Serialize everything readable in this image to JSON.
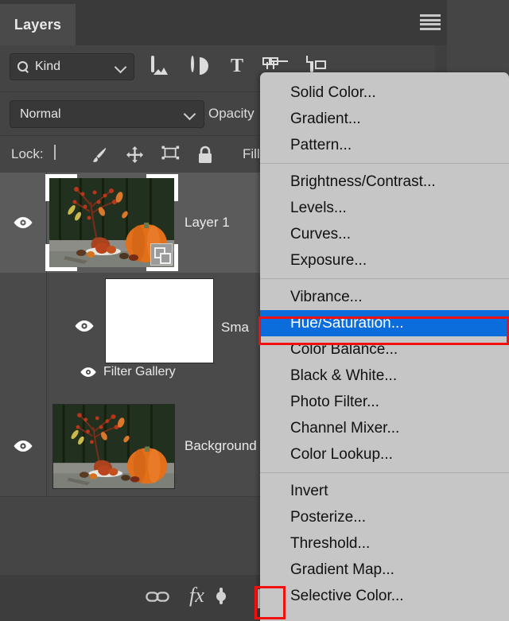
{
  "panel": {
    "tab_label": "Layers",
    "panel_menu_icon": "hamburger-menu-icon"
  },
  "filter_row": {
    "kind_label": "Kind",
    "search_icon": "search-icon",
    "chevron_icon": "chevron-down-icon",
    "filter_icons": [
      {
        "name": "filter-pixel-layers-icon",
        "icon": "image-icon"
      },
      {
        "name": "filter-adjustment-layers-icon",
        "icon": "adjustment-circle-icon"
      },
      {
        "name": "filter-type-layers-icon",
        "icon": "text-t-icon"
      },
      {
        "name": "filter-shape-layers-icon",
        "icon": "shape-icon"
      },
      {
        "name": "filter-smart-objects-icon",
        "icon": "smart-object-icon"
      },
      {
        "name": "filter-toggle-icon",
        "icon": "circle-toggle-icon"
      }
    ]
  },
  "blend_row": {
    "blend_mode": "Normal",
    "opacity_label": "Opacity",
    "chevron_icon": "chevron-down-icon"
  },
  "lock_row": {
    "lock_label": "Lock:",
    "fill_label": "Fill",
    "lock_icons": [
      {
        "name": "lock-transparent-pixels-icon",
        "icon": "checkerboard-icon"
      },
      {
        "name": "lock-image-pixels-icon",
        "icon": "brush-icon"
      },
      {
        "name": "lock-position-icon",
        "icon": "move-arrows-icon"
      },
      {
        "name": "lock-artboard-nesting-icon",
        "icon": "artboard-icon"
      },
      {
        "name": "lock-all-icon",
        "icon": "padlock-icon"
      }
    ]
  },
  "layers": [
    {
      "name": "Layer 1",
      "visible": true,
      "selected": true,
      "thumb_type": "photo-pumpkin",
      "badge": "smart-object-badge"
    },
    {
      "name": "Sma",
      "visible": true,
      "selected": false,
      "thumb_type": "white",
      "sub_label": "Filter Gallery",
      "sub_visible": true
    },
    {
      "name": "Background",
      "visible": true,
      "selected": false,
      "thumb_type": "photo-pumpkin"
    }
  ],
  "bottom_bar": {
    "buttons": [
      {
        "name": "link-layers-button",
        "icon": "link-icon"
      },
      {
        "name": "layer-style-button",
        "icon": "fx-icon",
        "label": "fx"
      },
      {
        "name": "add-layer-mask-button",
        "icon": "mask-icon"
      },
      {
        "name": "new-adjustment-layer-button",
        "icon": "half-circle-icon"
      }
    ]
  },
  "context_menu": {
    "selected_item": "Hue/Saturation...",
    "groups": [
      {
        "items": [
          "Solid Color...",
          "Gradient...",
          "Pattern..."
        ]
      },
      {
        "items": [
          "Brightness/Contrast...",
          "Levels...",
          "Curves...",
          "Exposure..."
        ]
      },
      {
        "items": [
          "Vibrance...",
          "Hue/Saturation...",
          "Color Balance...",
          "Black & White...",
          "Photo Filter...",
          "Channel Mixer...",
          "Color Lookup..."
        ]
      },
      {
        "items": [
          "Invert",
          "Posterize...",
          "Threshold...",
          "Gradient Map...",
          "Selective Color..."
        ]
      }
    ]
  },
  "annotations": {
    "highlight_color": "#f40f0f",
    "selection_color": "#0a6ddb",
    "boxes": [
      {
        "name": "hue-saturation-highlight-box"
      },
      {
        "name": "adjustment-layer-button-highlight-box"
      }
    ]
  }
}
